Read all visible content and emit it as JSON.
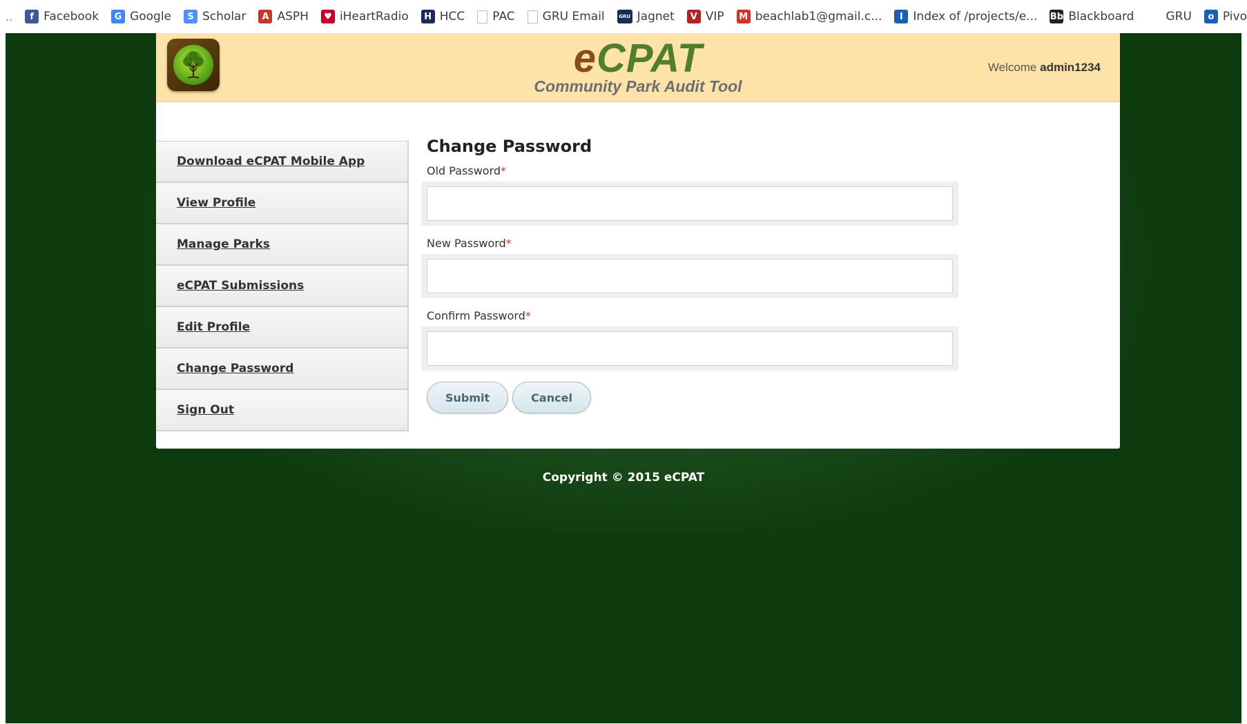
{
  "bookmarks": {
    "lead": "..",
    "items": [
      {
        "label": "Facebook",
        "icon": "facebook-icon",
        "glyph": "f",
        "color": "#3b5998"
      },
      {
        "label": "Google",
        "icon": "google-icon",
        "glyph": "G",
        "color": "#4285f4"
      },
      {
        "label": "Scholar",
        "icon": "scholar-icon",
        "glyph": "S",
        "color": "#4d90fe"
      },
      {
        "label": "ASPH",
        "icon": "asph-icon",
        "glyph": "A",
        "color": "#c0392b"
      },
      {
        "label": "iHeartRadio",
        "icon": "iheartradio-icon",
        "glyph": "♥",
        "color": "#c6002b"
      },
      {
        "label": "HCC",
        "icon": "hcc-icon",
        "glyph": "H",
        "color": "#1a2a5a"
      },
      {
        "label": "PAC",
        "icon": "page-icon",
        "glyph": "",
        "color": ""
      },
      {
        "label": "GRU Email",
        "icon": "page-icon",
        "glyph": "",
        "color": ""
      },
      {
        "label": "Jagnet",
        "icon": "gru-icon",
        "glyph": "GRU",
        "color": "#1a2a5a"
      },
      {
        "label": "VIP",
        "icon": "vip-icon",
        "glyph": "V",
        "color": "#b22222"
      },
      {
        "label": "beachlab1@gmail.c...",
        "icon": "gmail-icon",
        "glyph": "M",
        "color": "#d93025"
      },
      {
        "label": "Index of /projects/e...",
        "icon": "index-icon",
        "glyph": "I",
        "color": "#1a5fb4"
      },
      {
        "label": "Blackboard",
        "icon": "blackboard-icon",
        "glyph": "Bb",
        "color": "#222222"
      },
      {
        "label": "GRU",
        "icon": "",
        "glyph": "",
        "color": ""
      },
      {
        "label": "Pivot",
        "icon": "pivot-icon",
        "glyph": "o",
        "color": "#1a5fb4"
      }
    ]
  },
  "header": {
    "brand_e": "e",
    "brand_rest": "CPAT",
    "subtitle": "Community Park Audit Tool",
    "welcome_prefix": "Welcome ",
    "username": "admin1234"
  },
  "sidebar": {
    "items": [
      {
        "label": "Download eCPAT Mobile App",
        "name": "sidebar-item-download-app"
      },
      {
        "label": "View Profile",
        "name": "sidebar-item-view-profile"
      },
      {
        "label": "Manage Parks",
        "name": "sidebar-item-manage-parks"
      },
      {
        "label": "eCPAT Submissions",
        "name": "sidebar-item-submissions"
      },
      {
        "label": "Edit Profile",
        "name": "sidebar-item-edit-profile"
      },
      {
        "label": "Change Password",
        "name": "sidebar-item-change-password"
      },
      {
        "label": "Sign Out",
        "name": "sidebar-item-sign-out"
      }
    ]
  },
  "form": {
    "title": "Change Password",
    "required_marker": "*",
    "fields": [
      {
        "label": "Old Password",
        "value": "",
        "placeholder": ""
      },
      {
        "label": "New Password",
        "value": "",
        "placeholder": ""
      },
      {
        "label": "Confirm Password",
        "value": "",
        "placeholder": ""
      }
    ],
    "submit_label": "Submit",
    "cancel_label": "Cancel"
  },
  "footer": {
    "copyright": "Copyright © 2015 eCPAT"
  },
  "colors": {
    "page_background": "#0d3b0e",
    "header_background": "#fde3a7",
    "brand_e": "#8a4b1a",
    "brand_rest": "#4f7f28",
    "required": "#c0392b"
  }
}
